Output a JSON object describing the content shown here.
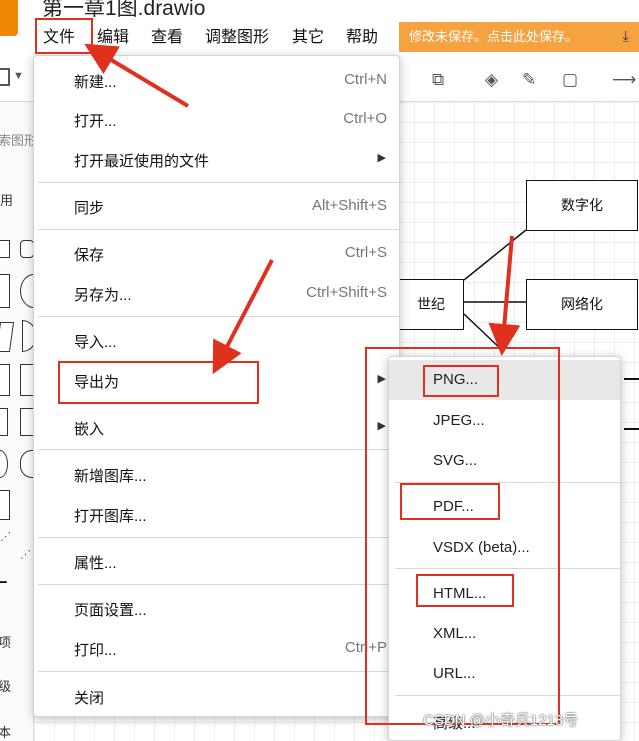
{
  "app": {
    "title": "第一章1图.drawio",
    "save_banner": "修改未保存。点击此处保存。",
    "save_icon": "download-icon"
  },
  "menubar": [
    {
      "label": "文件"
    },
    {
      "label": "编辑"
    },
    {
      "label": "查看"
    },
    {
      "label": "调整图形"
    },
    {
      "label": "其它"
    },
    {
      "label": "帮助"
    }
  ],
  "left_panel": {
    "search_placeholder": "索图形",
    "general_label": "用",
    "labels": [
      "项",
      "级",
      "本"
    ]
  },
  "canvas": {
    "nodes": [
      {
        "label": "数字化"
      },
      {
        "label": "世纪"
      },
      {
        "label": "网络化"
      }
    ]
  },
  "file_menu": {
    "items": [
      {
        "label": "新建...",
        "shortcut": "Ctrl+N"
      },
      {
        "label": "打开...",
        "shortcut": "Ctrl+O"
      },
      {
        "label": "打开最近使用的文件",
        "submenu": true
      },
      {
        "label": "同步",
        "shortcut": "Alt+Shift+S"
      },
      {
        "label": "保存",
        "shortcut": "Ctrl+S"
      },
      {
        "label": "另存为...",
        "shortcut": "Ctrl+Shift+S"
      },
      {
        "label": "导入..."
      },
      {
        "label": "导出为",
        "submenu": true
      },
      {
        "label": "嵌入",
        "submenu": true
      },
      {
        "label": "新增图库..."
      },
      {
        "label": "打开图库..."
      },
      {
        "label": "属性..."
      },
      {
        "label": "页面设置..."
      },
      {
        "label": "打印...",
        "shortcut": "Ctrl+P"
      },
      {
        "label": "关闭"
      }
    ]
  },
  "export_submenu": {
    "items": [
      {
        "label": "PNG...",
        "highlighted": true
      },
      {
        "label": "JPEG..."
      },
      {
        "label": "SVG..."
      },
      {
        "label": "PDF..."
      },
      {
        "label": "VSDX (beta)..."
      },
      {
        "label": "HTML..."
      },
      {
        "label": "XML..."
      },
      {
        "label": "URL..."
      },
      {
        "label": "高级..."
      }
    ]
  },
  "watermark": "CSDN @小奇兵1213号",
  "colors": {
    "accent": "#f5a340",
    "annotation": "#e0301e",
    "logo": "#f08705"
  }
}
